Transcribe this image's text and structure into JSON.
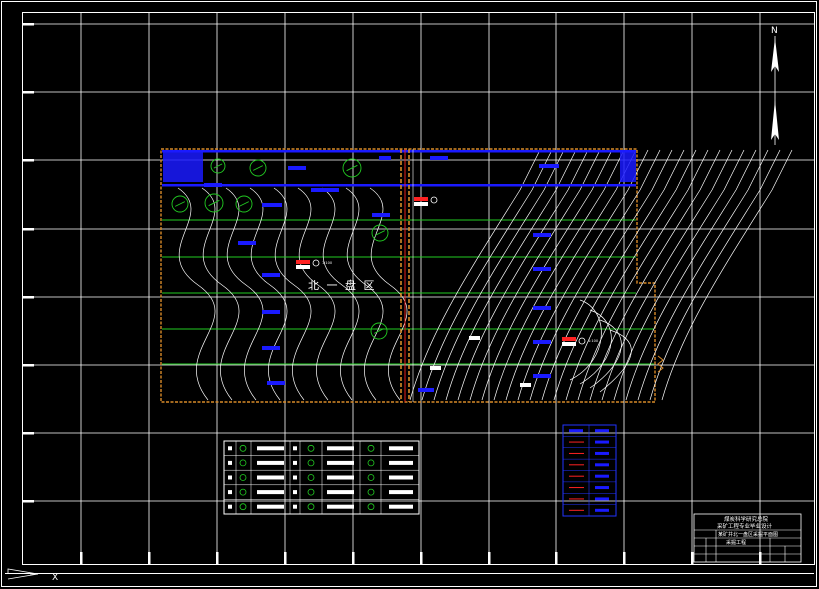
{
  "drawing": {
    "district_label": "北 一 盘 区",
    "small_label_1": "1:100",
    "small_label_2": "1:100",
    "north_symbol": "N",
    "ucs_x_label": "X"
  },
  "colors": {
    "background": "#000000",
    "grid": "#ffffff",
    "contour": "#ffffff",
    "boundary": "#d88a28",
    "roadway": "#1a1aff",
    "green_line": "#22cc22",
    "red_marker": "#ff2222",
    "legend_border": "#ffffff",
    "legend2_border": "#2233ff"
  },
  "title_block": {
    "line1": "煤炭科学研究总院",
    "line2": "采矿工程专业毕业设计",
    "line3": "某矿井北一盘区采掘平面图",
    "line4": "采掘工程"
  },
  "icons": [
    "north-arrow-icon",
    "ucs-icon"
  ]
}
